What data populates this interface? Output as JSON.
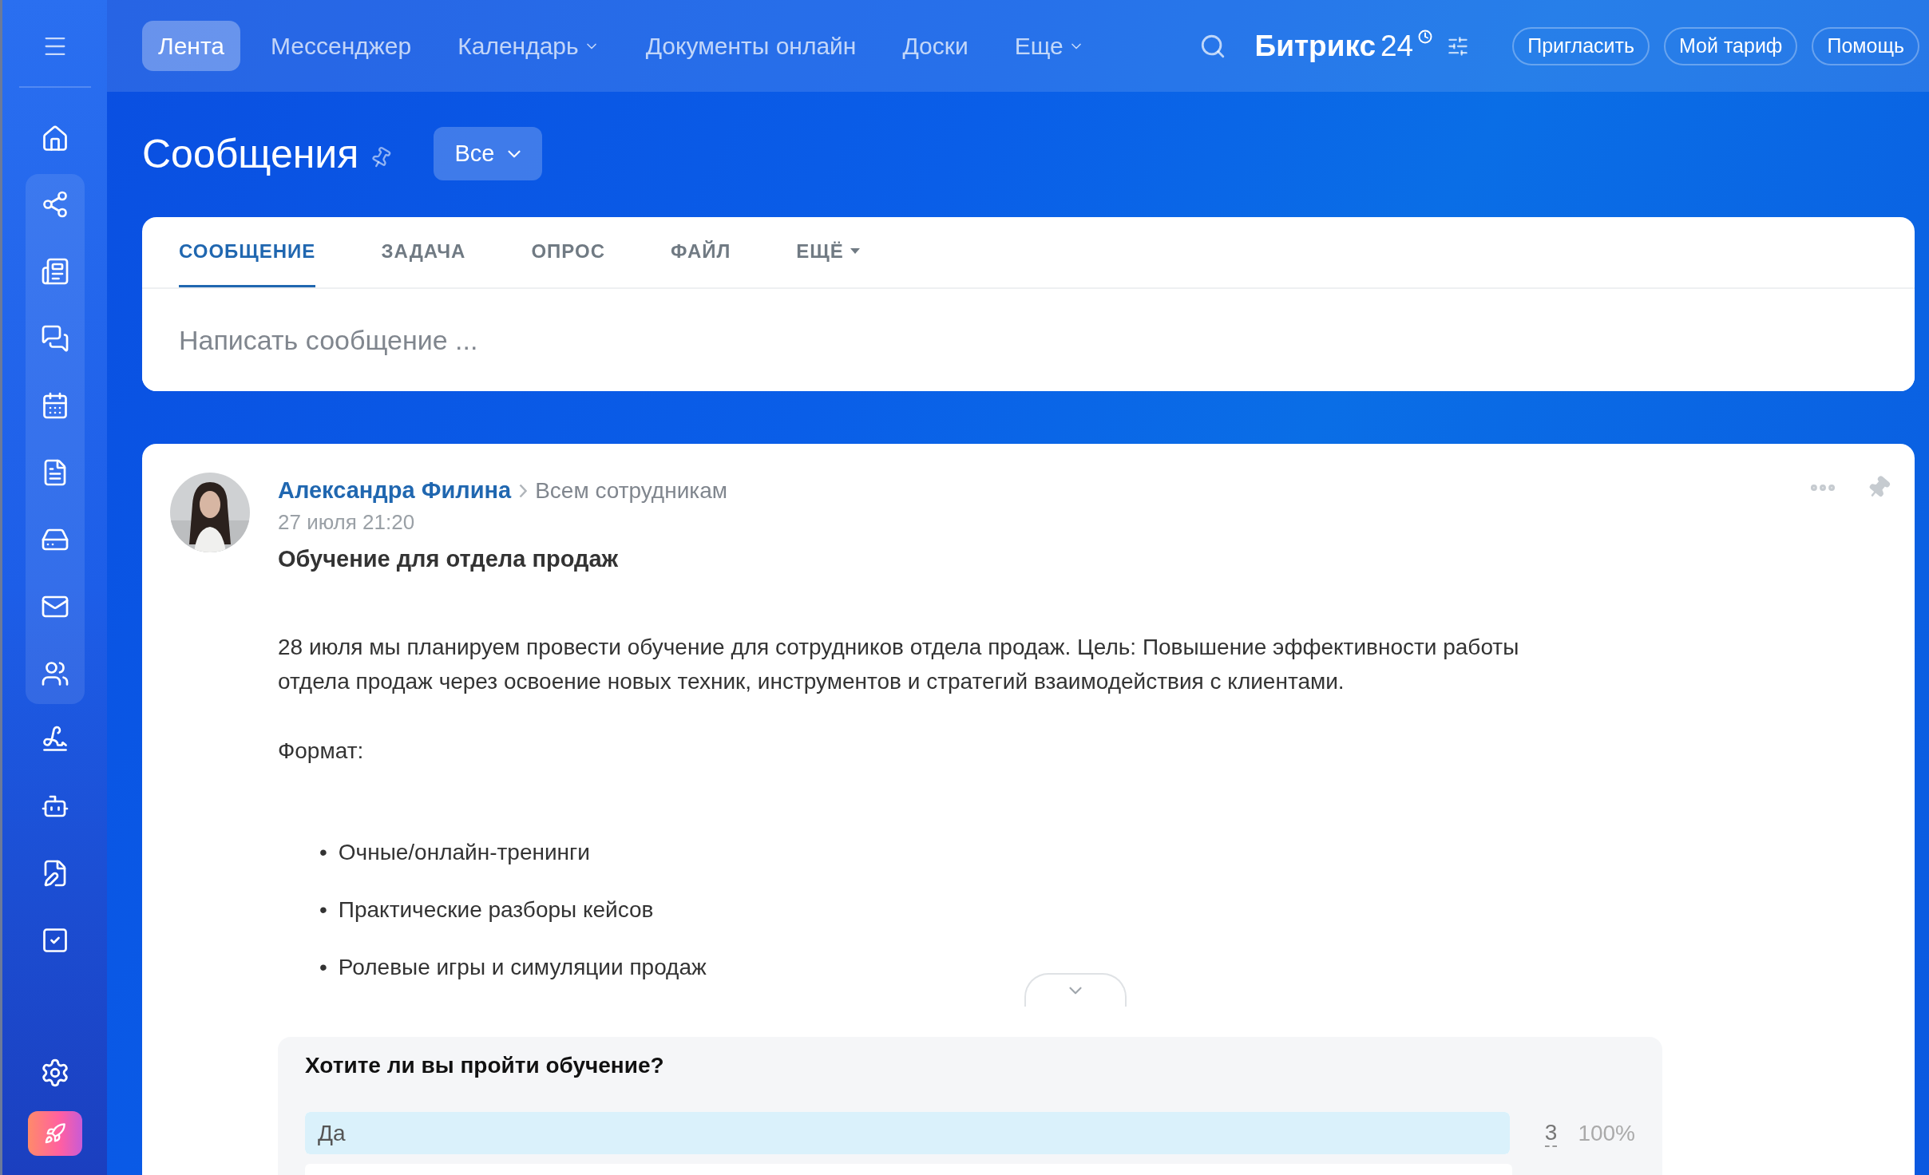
{
  "sidebar": {
    "items": [
      {
        "kind": "home",
        "selected": false
      },
      {
        "kind": "flow",
        "selected": false
      },
      {
        "kind": "news",
        "selected": false
      },
      {
        "kind": "chat",
        "selected": false
      },
      {
        "kind": "calendar",
        "selected": false
      },
      {
        "kind": "document",
        "selected": false
      },
      {
        "kind": "drive",
        "selected": false
      },
      {
        "kind": "mail",
        "selected": false
      },
      {
        "kind": "people",
        "selected": false
      },
      {
        "kind": "sign",
        "selected": false
      },
      {
        "kind": "bot",
        "selected": false
      },
      {
        "kind": "edit",
        "selected": false
      },
      {
        "kind": "task",
        "selected": false
      }
    ]
  },
  "top_nav": [
    {
      "label": "Лента",
      "selected": true,
      "dropdown": false
    },
    {
      "label": "Мессенджер",
      "selected": false,
      "dropdown": false
    },
    {
      "label": "Календарь",
      "selected": false,
      "dropdown": true
    },
    {
      "label": "Документы онлайн",
      "selected": false,
      "dropdown": false
    },
    {
      "label": "Доски",
      "selected": false,
      "dropdown": false
    },
    {
      "label": "Еще",
      "selected": false,
      "dropdown": true
    }
  ],
  "brand": {
    "name": "Битрикс",
    "number": "24"
  },
  "header_buttons": [
    "Пригласить",
    "Мой тариф",
    "Помощь"
  ],
  "page": {
    "title": "Сообщения",
    "filter": "Все"
  },
  "composer": {
    "tabs": [
      {
        "label": "СООБЩЕНИЕ",
        "selected": true,
        "dropdown": false
      },
      {
        "label": "ЗАДАЧА",
        "selected": false,
        "dropdown": false
      },
      {
        "label": "ОПРОС",
        "selected": false,
        "dropdown": false
      },
      {
        "label": "ФАЙЛ",
        "selected": false,
        "dropdown": false
      },
      {
        "label": "ЕЩЁ",
        "selected": false,
        "dropdown": true
      }
    ],
    "placeholder": "Написать сообщение ..."
  },
  "post": {
    "author": "Александра Филина",
    "recipient": "Всем сотрудникам",
    "date": "27 июля 21:20",
    "title": "Обучение для отдела продаж",
    "paragraphs": [
      "28 июля мы планируем провести обучение для сотрудников отдела продаж. Цель: Повышение эффективности работы отдела продаж через освоение новых техник, инструментов и стратегий взаимодействия с клиентами.",
      "Формат:"
    ],
    "bullets": [
      {
        "marker": "•",
        "text": "Очные/онлайн-тренинги"
      },
      {
        "marker": "•",
        "text": "Практические разборы кейсов"
      },
      {
        "marker": "•",
        "text": "Ролевые игры и симуляции продаж"
      }
    ],
    "poll": {
      "question": "Хотите ли вы пройти обучение?",
      "answers": [
        {
          "label": "Да",
          "count": "3",
          "percent": "100%",
          "level": 1
        },
        {
          "level": 0
        }
      ]
    }
  }
}
